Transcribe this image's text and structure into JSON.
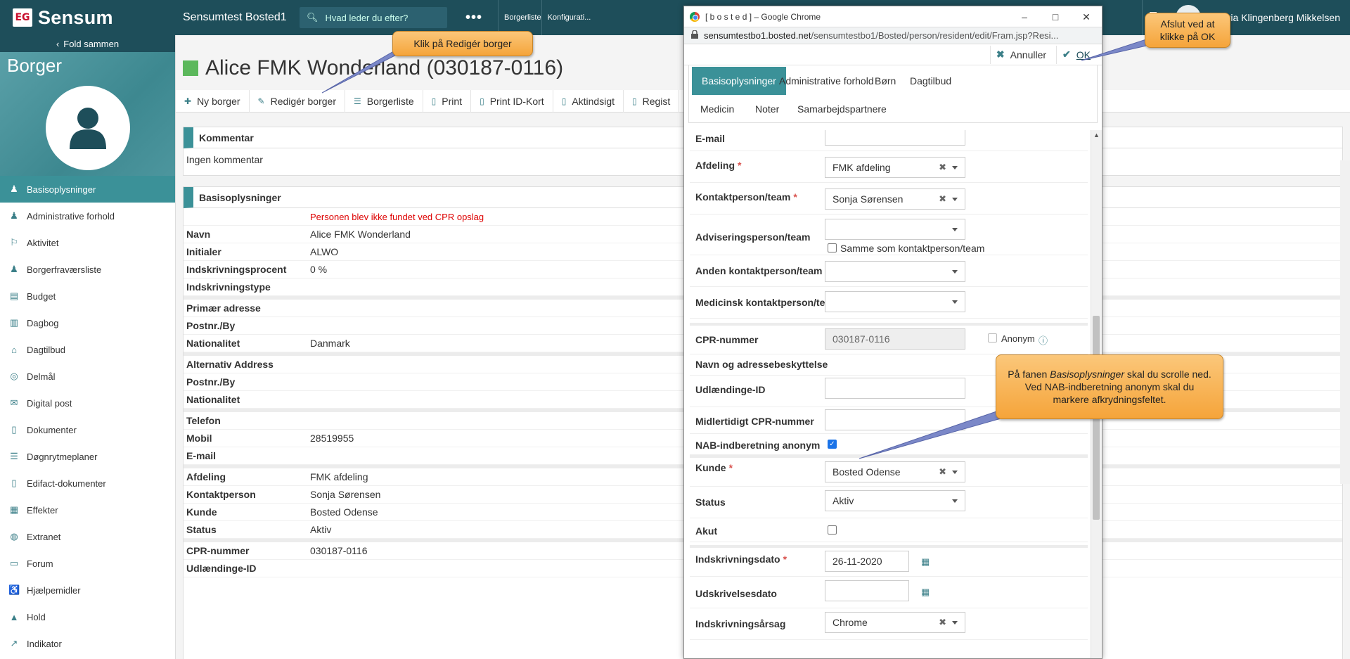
{
  "topbar": {
    "brand_mark": "EG",
    "brand": "Sensum",
    "site_title": "Sensumtest Bosted1",
    "search_placeholder": "Hvad leder du efter?",
    "more": "•••",
    "nav": [
      "Borgerliste",
      "Konfigurati..."
    ],
    "user_name": "Maria Klingenberg Mikkelsen"
  },
  "sidebar": {
    "fold_label": "Fold sammen",
    "title": "Borger",
    "items": [
      {
        "label": "Basisoplysninger",
        "icon": "person-icon",
        "glyph": "♟",
        "active": true
      },
      {
        "label": "Administrative forhold",
        "icon": "person-icon",
        "glyph": "♟"
      },
      {
        "label": "Aktivitet",
        "icon": "running-icon",
        "glyph": "⚐"
      },
      {
        "label": "Borgerfraværsliste",
        "icon": "person-icon",
        "glyph": "♟"
      },
      {
        "label": "Budget",
        "icon": "calculator-icon",
        "glyph": "▤"
      },
      {
        "label": "Dagbog",
        "icon": "book-icon",
        "glyph": "▥"
      },
      {
        "label": "Dagtilbud",
        "icon": "house-icon",
        "glyph": "⌂"
      },
      {
        "label": "Delmål",
        "icon": "target-icon",
        "glyph": "◎"
      },
      {
        "label": "Digital post",
        "icon": "envelope-icon",
        "glyph": "✉"
      },
      {
        "label": "Dokumenter",
        "icon": "document-icon",
        "glyph": "▯"
      },
      {
        "label": "Døgnrytmeplaner",
        "icon": "list-icon",
        "glyph": "☰"
      },
      {
        "label": "Edifact-dokumenter",
        "icon": "document-icon",
        "glyph": "▯"
      },
      {
        "label": "Effekter",
        "icon": "chart-icon",
        "glyph": "▦"
      },
      {
        "label": "Extranet",
        "icon": "globe-icon",
        "glyph": "◍"
      },
      {
        "label": "Forum",
        "icon": "chat-icon",
        "glyph": "▭"
      },
      {
        "label": "Hjælpemidler",
        "icon": "wheelchair-icon",
        "glyph": "♿"
      },
      {
        "label": "Hold",
        "icon": "graduation-icon",
        "glyph": "▲"
      },
      {
        "label": "Indikator",
        "icon": "line-chart-icon",
        "glyph": "↗"
      }
    ]
  },
  "main": {
    "page_title": "Alice FMK Wonderland (030187-0116)",
    "status_color": "#5cb85c",
    "toolbar": [
      {
        "label": "Ny borger",
        "icon": "plus-icon",
        "glyph": "✚"
      },
      {
        "label": "Redigér borger",
        "icon": "pencil-icon",
        "glyph": "✎"
      },
      {
        "label": "Borgerliste",
        "icon": "list-icon",
        "glyph": "☰"
      },
      {
        "label": "Print",
        "icon": "pdf-icon",
        "glyph": "▯"
      },
      {
        "label": "Print ID-Kort",
        "icon": "pdf-icon",
        "glyph": "▯"
      },
      {
        "label": "Aktindsigt",
        "icon": "pdf-icon",
        "glyph": "▯"
      },
      {
        "label": "Regist",
        "icon": "pdf-icon",
        "glyph": "▯"
      }
    ],
    "comment": {
      "title": "Kommentar",
      "body": "Ingen kommentar"
    },
    "basis": {
      "title": "Basisoplysninger",
      "rows": [
        {
          "label": "",
          "value": "Personen blev ikke fundet ved CPR opslag",
          "error": true
        },
        {
          "label": "Navn",
          "value": "Alice FMK Wonderland"
        },
        {
          "label": "Initialer",
          "value": "ALWO"
        },
        {
          "label": "Indskrivningsprocent",
          "value": "0 %"
        },
        {
          "label": "Indskrivningstype",
          "value": ""
        },
        {
          "label": "Primær adresse",
          "value": "",
          "group": true
        },
        {
          "label": "Postnr./By",
          "value": ""
        },
        {
          "label": "Nationalitet",
          "value": "Danmark"
        },
        {
          "label": "Alternativ Address",
          "value": "",
          "group": true
        },
        {
          "label": "Postnr./By",
          "value": ""
        },
        {
          "label": "Nationalitet",
          "value": ""
        },
        {
          "label": "Telefon",
          "value": "",
          "group": true
        },
        {
          "label": "Mobil",
          "value": "28519955"
        },
        {
          "label": "E-mail",
          "value": ""
        },
        {
          "label": "Afdeling",
          "value": "FMK afdeling",
          "group": true
        },
        {
          "label": "Kontaktperson",
          "value": "Sonja Sørensen"
        },
        {
          "label": "Kunde",
          "value": "Bosted Odense"
        },
        {
          "label": "Status",
          "value": "Aktiv"
        },
        {
          "label": "CPR-nummer",
          "value": "030187-0116",
          "group": true
        },
        {
          "label": "Udlændinge-ID",
          "value": ""
        }
      ]
    }
  },
  "popup": {
    "window_title": "[ b o s t e d ] – Google Chrome",
    "url_host": "sensumtestbo1.bosted.net",
    "url_path": "/sensumtestbo1/Bosted/person/resident/edit/Fram.jsp?Resi...",
    "cancel_label": "Annuller",
    "ok_label": "OK",
    "tabs": [
      "Basisoplysninger",
      "Administrative forhold",
      "Børn",
      "Dagtilbud",
      "Medicin",
      "Noter",
      "Samarbejdspartnere"
    ],
    "form": {
      "email_label": "E-mail",
      "afdeling_label": "Afdeling",
      "afdeling_value": "FMK afdeling",
      "kontakt_label": "Kontaktperson/team",
      "kontakt_value": "Sonja Sørensen",
      "advis_label": "Adviseringsperson/team",
      "samme_label": "Samme som kontaktperson/team",
      "anden_label": "Anden kontaktperson/team",
      "medicinsk_label": "Medicinsk kontaktperson/team",
      "cpr_label": "CPR-nummer",
      "cpr_value": "030187-0116",
      "anonym_label": "Anonym",
      "navn_beskyt_label": "Navn og adressebeskyttelse",
      "udl_label": "Udlændinge-ID",
      "midl_cpr_label": "Midlertidigt CPR-nummer",
      "nab_label": "NAB-indberetning anonym",
      "kunde_label": "Kunde",
      "kunde_value": "Bosted Odense",
      "status_label": "Status",
      "status_value": "Aktiv",
      "akut_label": "Akut",
      "indskr_dato_label": "Indskrivningsdato",
      "indskr_dato_value": "26-11-2020",
      "udskr_dato_label": "Udskrivelsesdato",
      "indskr_aarsag_label": "Indskrivningsårsag",
      "indskr_aarsag_value": "Chrome"
    }
  },
  "callouts": {
    "edit": "Klik på Redigér borger",
    "ok": "Afslut ved at klikke på OK",
    "nab_pre": "På fanen ",
    "nab_em": "Basisoplysninger",
    "nab_post": " skal du scrolle ned. Ved NAB-indberetning anonym skal du markere afkrydningsfeltet."
  },
  "colors": {
    "topbar": "#1e4e5a",
    "accent": "#3b9198",
    "callout": "#f5a43a",
    "required": "#d9534f",
    "error": "#dd0000"
  }
}
